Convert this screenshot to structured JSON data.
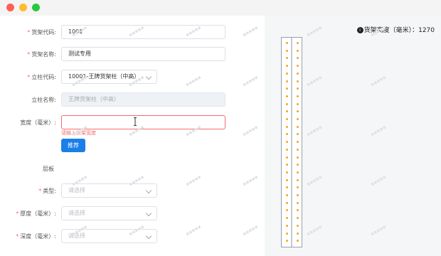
{
  "window": {
    "controls": [
      "close",
      "minimize",
      "maximize"
    ]
  },
  "form": {
    "shelf_code": {
      "label": "货架代码:",
      "value": "1001",
      "required": true
    },
    "shelf_name": {
      "label": "货架名称:",
      "value": "测试专用",
      "required": true
    },
    "column_code": {
      "label": "立柱代码:",
      "value": "10001-王牌货架柱（中高）",
      "required": true
    },
    "column_name": {
      "label": "立柱名称:",
      "value": "王牌货架柱（中高）"
    },
    "width": {
      "label": "宽度（毫米）:",
      "value": "",
      "error": "请输入货架宽度"
    },
    "recommend_button": "推荐",
    "section_title": "层板",
    "type": {
      "label": "类型:",
      "placeholder": "请选择",
      "required": true
    },
    "thickness": {
      "label": "厚度（毫米）:",
      "placeholder": "请选择",
      "required": true
    },
    "depth": {
      "label": "深度（毫米）:",
      "placeholder": "请选择",
      "required": true
    }
  },
  "preview": {
    "height_label": "货架高度（毫米）：",
    "height_value": "1270",
    "icon": "info-icon",
    "hole_rows": 27,
    "colors": {
      "rack_hole": "#f5a623",
      "rack_border": "#9aa0a8"
    }
  },
  "colors": {
    "primary": "#1a7fe8",
    "error": "#f56c6c"
  }
}
